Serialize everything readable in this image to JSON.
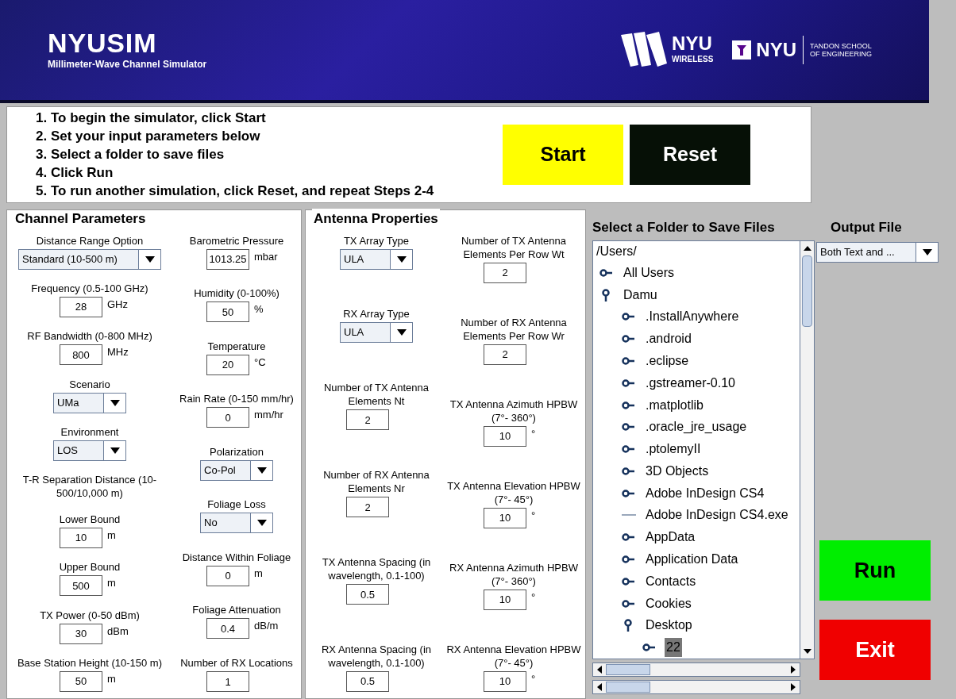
{
  "header": {
    "title": "NYUSIM",
    "subtitle": "Millimeter-Wave Channel Simulator",
    "logos": [
      {
        "kind": "wireless",
        "name": "NYU",
        "tagline": "WIRELESS"
      },
      {
        "kind": "tandon",
        "name": "NYU",
        "tagline": "TANDON SCHOOL OF ENGINEERING"
      }
    ]
  },
  "instructions": [
    "1. To begin the simulator, click Start",
    "2. Set your input parameters below",
    "3. Select a folder to save files",
    "4. Click Run",
    "5. To run another simulation, click Reset, and repeat Steps 2-4"
  ],
  "top_buttons": [
    {
      "kind": "start",
      "label": "Start"
    },
    {
      "kind": "reset",
      "label": "Reset"
    }
  ],
  "channel_parameters": {
    "title": "Channel Parameters",
    "columns": [
      [
        {
          "kind": "select",
          "label": "Distance Range Option",
          "value": "Standard (10-500 m)"
        },
        {
          "kind": "input",
          "label": "Frequency (0.5-100 GHz)",
          "value": "28",
          "unit": "GHz"
        },
        {
          "kind": "input",
          "label": "RF Bandwidth (0-800 MHz)",
          "value": "800",
          "unit": "MHz"
        },
        {
          "kind": "select",
          "label": "Scenario",
          "value": "UMa"
        },
        {
          "kind": "select",
          "label": "Environment",
          "value": "LOS"
        },
        {
          "kind": "heading",
          "label": "T-R Separation Distance (10-500/10,000 m)"
        },
        {
          "kind": "input",
          "label": "Lower Bound",
          "value": "10",
          "unit": "m"
        },
        {
          "kind": "input",
          "label": "Upper Bound",
          "value": "500",
          "unit": "m"
        },
        {
          "kind": "input",
          "label": "TX Power (0-50 dBm)",
          "value": "30",
          "unit": "dBm"
        },
        {
          "kind": "input",
          "label": "Base Station Height (10-150 m)",
          "value": "50",
          "unit": "m"
        }
      ],
      [
        {
          "kind": "input",
          "label": "Barometric Pressure",
          "value": "1013.25",
          "unit": "mbar"
        },
        {
          "kind": "input",
          "label": "Humidity (0-100%)",
          "value": "50",
          "unit": "%"
        },
        {
          "kind": "input",
          "label": "Temperature",
          "value": "20",
          "unit": "°C"
        },
        {
          "kind": "input",
          "label": "Rain Rate (0-150 mm/hr)",
          "value": "0",
          "unit": "mm/hr"
        },
        {
          "kind": "select",
          "label": "Polarization",
          "value": "Co-Pol"
        },
        {
          "kind": "select",
          "label": "Foliage Loss",
          "value": "No"
        },
        {
          "kind": "input",
          "label": "Distance Within Foliage",
          "value": "0",
          "unit": "m"
        },
        {
          "kind": "input",
          "label": "Foliage Attenuation",
          "value": "0.4",
          "unit": "dB/m"
        },
        {
          "kind": "input",
          "label": "Number of RX Locations",
          "value": "1"
        }
      ]
    ]
  },
  "antenna_properties": {
    "title": "Antenna Properties",
    "columns": [
      [
        {
          "kind": "select",
          "label": "TX Array Type",
          "value": "ULA"
        },
        {
          "kind": "select",
          "label": "RX Array Type",
          "value": "ULA"
        },
        {
          "kind": "input",
          "label": "Number of TX Antenna Elements Nt",
          "value": "2"
        },
        {
          "kind": "input",
          "label": "Number of RX Antenna Elements Nr",
          "value": "2"
        },
        {
          "kind": "input",
          "label": "TX Antenna Spacing (in wavelength, 0.1-100)",
          "value": "0.5"
        },
        {
          "kind": "input",
          "label": "RX Antenna Spacing (in wavelength, 0.1-100)",
          "value": "0.5"
        }
      ],
      [
        {
          "kind": "input",
          "label": "Number of TX Antenna Elements Per Row Wt",
          "value": "2"
        },
        {
          "kind": "input",
          "label": "Number of RX Antenna Elements Per Row Wr",
          "value": "2"
        },
        {
          "kind": "input",
          "label": "TX Antenna Azimuth HPBW (7°- 360°)",
          "value": "10",
          "unit": "°"
        },
        {
          "kind": "input",
          "label": "TX Antenna Elevation HPBW (7°- 45°)",
          "value": "10",
          "unit": "°"
        },
        {
          "kind": "input",
          "label": "RX Antenna Azimuth HPBW (7°- 360°)",
          "value": "10",
          "unit": "°"
        },
        {
          "kind": "input",
          "label": "RX Antenna Elevation HPBW (7°- 45°)",
          "value": "10",
          "unit": "°"
        }
      ]
    ]
  },
  "folder_picker": {
    "title": "Select a Folder to Save Files",
    "root": "/Users/",
    "tree": [
      {
        "kind": "folder",
        "label": "All Users",
        "expanded": false,
        "selected": false
      },
      {
        "kind": "folder",
        "label": "Damu",
        "expanded": true,
        "selected": false,
        "children": [
          {
            "kind": "folder",
            "label": ".InstallAnywhere",
            "expanded": false,
            "selected": false
          },
          {
            "kind": "folder",
            "label": ".android",
            "expanded": false,
            "selected": false
          },
          {
            "kind": "folder",
            "label": ".eclipse",
            "expanded": false,
            "selected": false
          },
          {
            "kind": "folder",
            "label": ".gstreamer-0.10",
            "expanded": false,
            "selected": false
          },
          {
            "kind": "folder",
            "label": ".matplotlib",
            "expanded": false,
            "selected": false
          },
          {
            "kind": "folder",
            "label": ".oracle_jre_usage",
            "expanded": false,
            "selected": false
          },
          {
            "kind": "folder",
            "label": ".ptolemyII",
            "expanded": false,
            "selected": false
          },
          {
            "kind": "folder",
            "label": "3D Objects",
            "expanded": false,
            "selected": false
          },
          {
            "kind": "folder",
            "label": "Adobe InDesign CS4",
            "expanded": false,
            "selected": false
          },
          {
            "kind": "file",
            "label": "Adobe InDesign CS4.exe",
            "selected": false
          },
          {
            "kind": "folder",
            "label": "AppData",
            "expanded": false,
            "selected": false
          },
          {
            "kind": "folder",
            "label": "Application Data",
            "expanded": false,
            "selected": false
          },
          {
            "kind": "folder",
            "label": "Contacts",
            "expanded": false,
            "selected": false
          },
          {
            "kind": "folder",
            "label": "Cookies",
            "expanded": false,
            "selected": false
          },
          {
            "kind": "folder",
            "label": "Desktop",
            "expanded": true,
            "selected": false,
            "children": [
              {
                "kind": "folder",
                "label": "22",
                "expanded": false,
                "selected": true
              }
            ]
          }
        ]
      }
    ]
  },
  "output_file": {
    "title": "Output File",
    "value": "Both Text and ..."
  },
  "action_buttons": [
    {
      "kind": "run",
      "label": "Run"
    },
    {
      "kind": "exit",
      "label": "Exit"
    }
  ]
}
